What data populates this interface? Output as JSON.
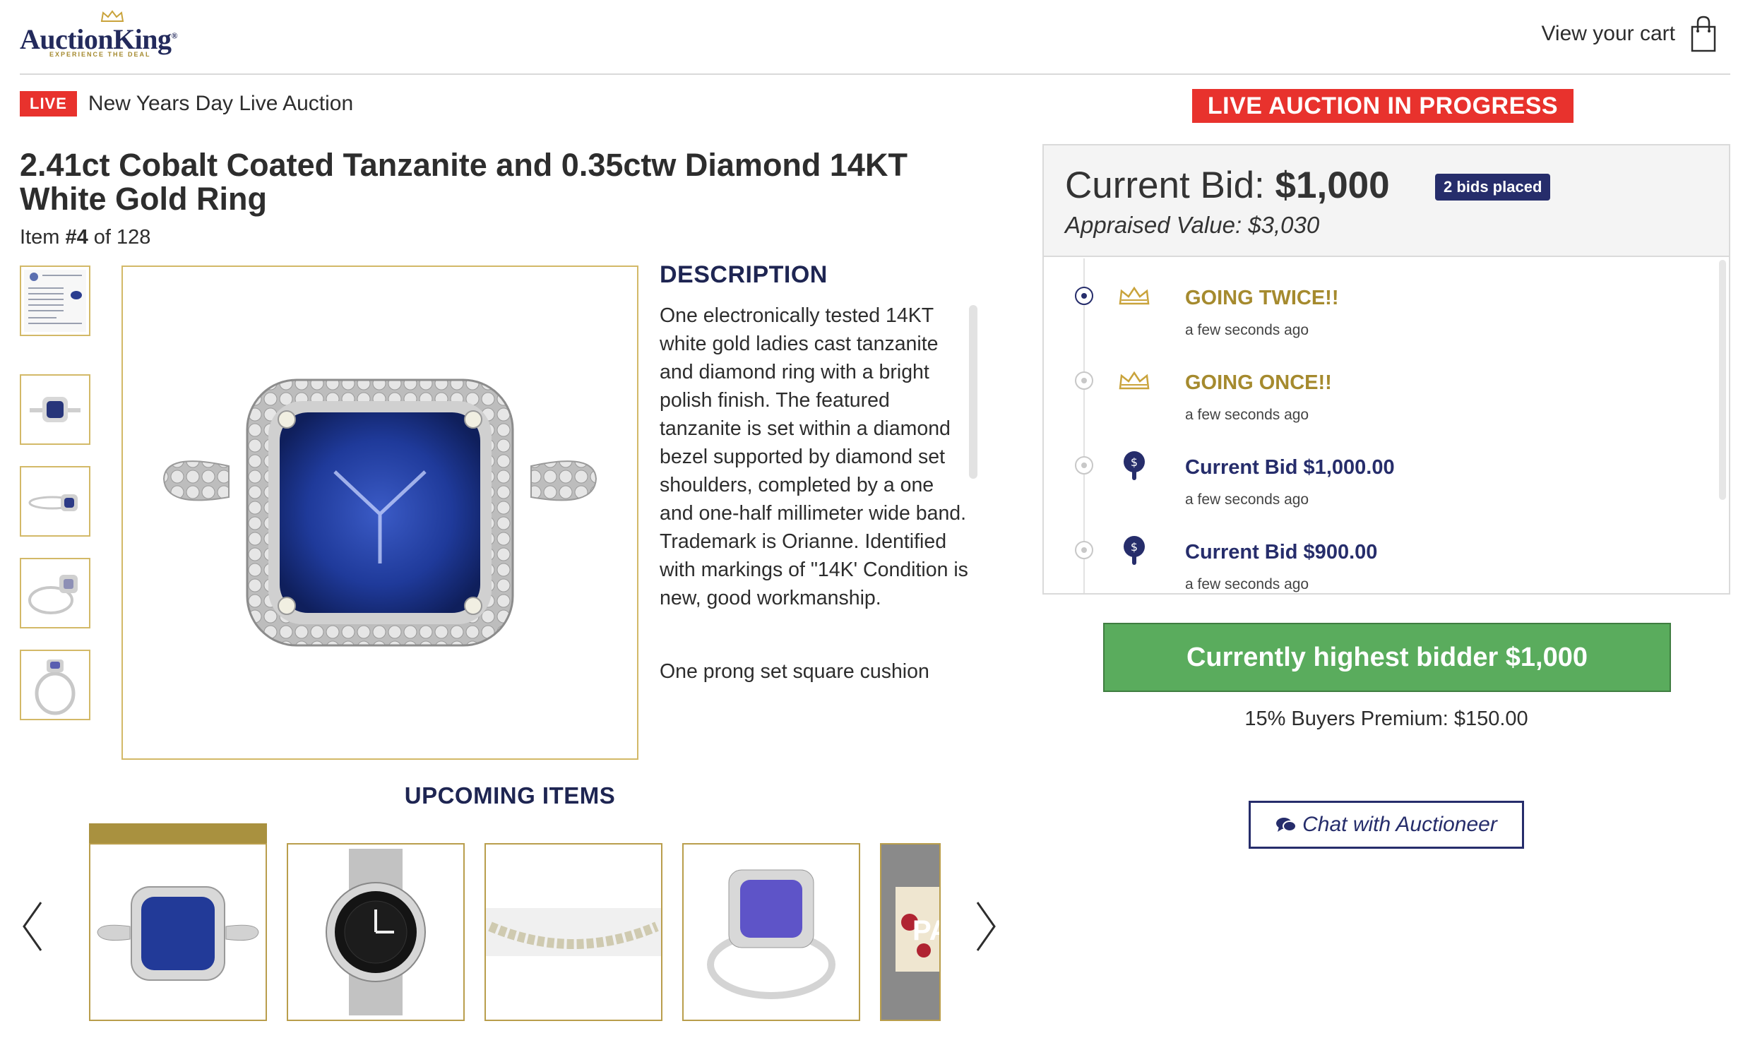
{
  "header": {
    "brand": "AuctionKing",
    "brand_mark": "®",
    "tagline": "EXPERIENCE THE DEAL",
    "cart_label": "View your cart"
  },
  "auction": {
    "live_badge": "LIVE",
    "title": "New Years Day Live Auction",
    "status_banner": "LIVE AUCTION IN PROGRESS"
  },
  "item": {
    "title": "2.41ct Cobalt Coated Tanzanite and 0.35ctw Diamond 14KT White Gold Ring",
    "count_prefix": "Item ",
    "count_number": "#4",
    "count_suffix": " of 128",
    "thumbnails": [
      "certificate",
      "ring-top",
      "ring-side",
      "ring-angle",
      "ring-front"
    ]
  },
  "description": {
    "heading": "DESCRIPTION",
    "paragraph1": "One electronically tested 14KT white gold ladies cast tanzanite and diamond ring with a bright polish finish. The featured tanzanite is set within a diamond bezel supported by diamond set shoulders, completed by a one and one-half millimeter wide band. Trademark is Orianne. Identified with markings of \"14K' Condition is new, good workmanship.",
    "paragraph2": "One prong set square cushion"
  },
  "upcoming": {
    "heading": "UPCOMING ITEMS",
    "prev_icon": "chevron-left-icon",
    "next_icon": "chevron-right-icon",
    "items": [
      "tanzanite-ring",
      "rolex-watch",
      "diamond-bracelet",
      "tanzanite-ring-2"
    ],
    "partial_label": "PA"
  },
  "bidding": {
    "current_label": "Current Bid: ",
    "current_value": "$1,000",
    "bids_badge": "2 bids placed",
    "appraised": "Appraised Value: $3,030",
    "timeline": [
      {
        "title": "GOING TWICE!!",
        "time": "a few seconds ago",
        "icon": "crown-icon",
        "style": "gold",
        "active": true
      },
      {
        "title": "GOING ONCE!!",
        "time": "a few seconds ago",
        "icon": "crown-icon",
        "style": "gold",
        "active": false
      },
      {
        "title": "Current Bid $1,000.00",
        "time": "a few seconds ago",
        "icon": "bid-paddle-icon",
        "style": "navy",
        "active": false
      },
      {
        "title": "Current Bid $900.00",
        "time": "a few seconds ago",
        "icon": "bid-paddle-icon",
        "style": "navy",
        "active": false
      }
    ],
    "highest_bidder": "Currently highest bidder $1,000",
    "premium": "15% Buyers Premium: $150.00",
    "chat_label": "Chat with Auctioneer"
  },
  "colors": {
    "navy": "#262d6b",
    "gold": "#a58a2e",
    "live_red": "#e8322d",
    "green": "#5aac5d"
  }
}
